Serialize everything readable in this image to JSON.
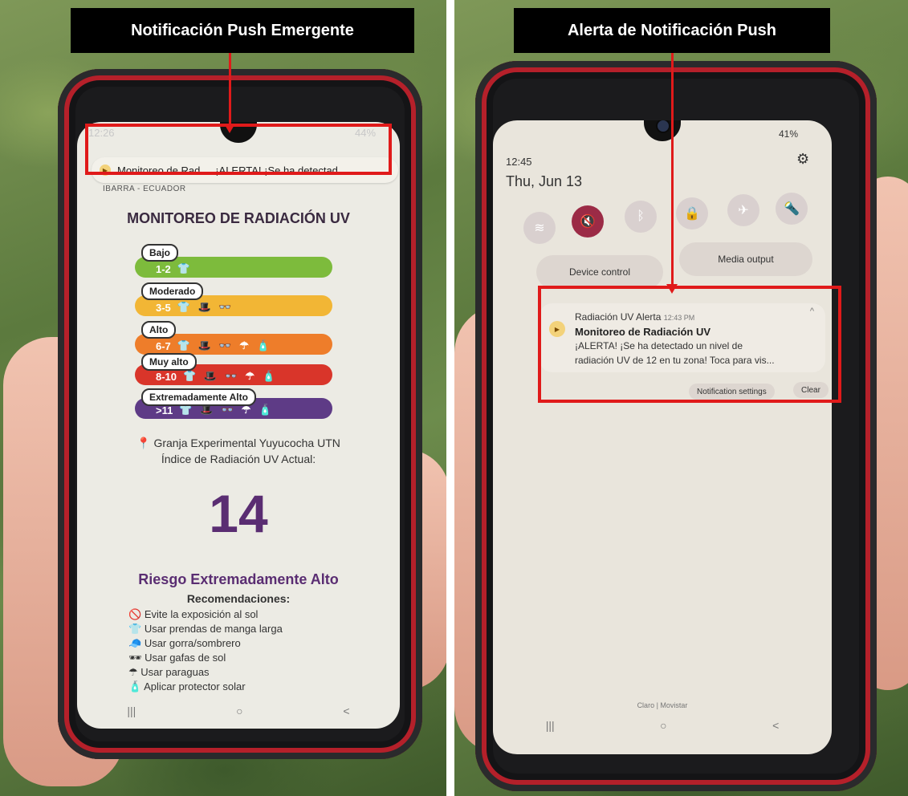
{
  "captions": {
    "left": "Notificación Push Emergente",
    "right": "Alerta de Notificación Push"
  },
  "left_phone": {
    "status_time": "12:26",
    "status_battery": "44%",
    "popup": {
      "app_name": "Monitoreo de Rad...",
      "message": "¡ALERTA! ¡Se ha detectad..."
    },
    "header_location": "IBARRA - ECUADOR",
    "title": "MONITOREO DE RADIACIÓN UV",
    "levels": [
      {
        "label": "Bajo",
        "range": "1-2",
        "color": "#7dbb3c",
        "icons": "👕"
      },
      {
        "label": "Moderado",
        "range": "3-5",
        "color": "#f2b635",
        "icons": "👕 🎩 👓"
      },
      {
        "label": "Alto",
        "range": "6-7",
        "color": "#ee7d2a",
        "icons": "👕 🎩 👓 ☂ 🧴"
      },
      {
        "label": "Muy alto",
        "range": "8-10",
        "color": "#d9352a",
        "icons": "👕 🎩 👓 ☂ 🧴"
      },
      {
        "label": "Extremadamente Alto",
        "range": ">11",
        "color": "#5e3b86",
        "icons": "👕 🎩 👓 ☂ 🧴"
      }
    ],
    "station": "Granja Experimental Yuyucocha UTN",
    "index_label": "Índice de Radiación UV Actual:",
    "index_value": "14",
    "risk": "Riesgo Extremadamente Alto",
    "recommendations_title": "Recomendaciones:",
    "recommendations": [
      "Evite la exposición al sol",
      "Usar prendas de manga larga",
      "Usar gorra/sombrero",
      "Usar gafas de sol",
      "Usar paraguas",
      "Aplicar protector solar"
    ],
    "nav": [
      "|||",
      "○",
      "<"
    ]
  },
  "right_phone": {
    "status": "41%",
    "time": "12:45",
    "date": "Thu, Jun 13",
    "device_control": "Device control",
    "media_output": "Media output",
    "notification": {
      "app": "Radiación UV Alerta",
      "time": "12:43 PM",
      "title": "Monitoreo de Radiación UV",
      "line1": "¡ALERTA! ¡Se ha detectado un nivel de",
      "line2": "radiación UV de 12 en tu zona! Toca para vis..."
    },
    "notification_settings": "Notification settings",
    "clear": "Clear",
    "carrier": "Claro | Movistar",
    "nav": [
      "|||",
      "○",
      "<"
    ]
  }
}
